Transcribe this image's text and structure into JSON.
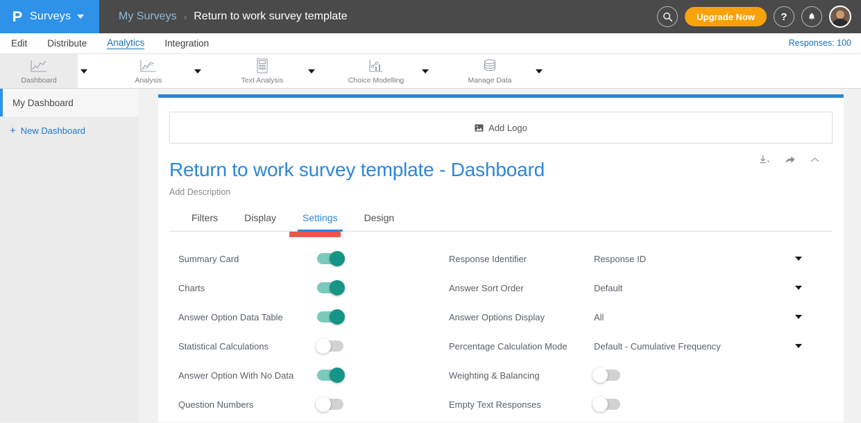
{
  "topbar": {
    "brand_logo": "P",
    "brand_name": "Surveys",
    "breadcrumb_parent": "My Surveys",
    "breadcrumb_sep": "›",
    "breadcrumb_current": "Return to work survey template",
    "search_icon": "search-icon",
    "upgrade_label": "Upgrade Now",
    "help_icon": "question-mark-icon",
    "notifications_icon": "bell-icon",
    "avatar": "user-avatar"
  },
  "navtabs": {
    "items": [
      {
        "label": "Edit",
        "active": false
      },
      {
        "label": "Distribute",
        "active": false
      },
      {
        "label": "Analytics",
        "active": true
      },
      {
        "label": "Integration",
        "active": false
      }
    ],
    "responses": "Responses: 100"
  },
  "toolbar": {
    "items": [
      {
        "label": "Dashboard",
        "icon": "line-chart-icon",
        "selected": true,
        "caret": true
      },
      {
        "label": "Analysis",
        "icon": "analysis-chart-icon",
        "selected": false,
        "caret": true
      },
      {
        "label": "Text Analysis",
        "icon": "text-analysis-icon",
        "selected": false,
        "caret": true
      },
      {
        "label": "Choice Modelling",
        "icon": "choice-modelling-icon",
        "selected": false,
        "caret": true
      },
      {
        "label": "Manage Data",
        "icon": "database-icon",
        "selected": false,
        "caret": true
      }
    ]
  },
  "sidebar": {
    "current_dashboard": "My Dashboard",
    "new_dashboard_label": "New Dashboard",
    "plus_icon": "plus-icon"
  },
  "main": {
    "add_logo_label": "Add Logo",
    "add_logo_icon": "image-icon",
    "dashboard_title": "Return to work survey template - Dashboard",
    "add_description": "Add Description",
    "actions": [
      {
        "name": "download-icon",
        "label": "Download"
      },
      {
        "name": "share-icon",
        "label": "Share"
      },
      {
        "name": "collapse-chevron-icon",
        "label": "Collapse"
      }
    ],
    "tabs": [
      {
        "label": "Filters",
        "active": false
      },
      {
        "label": "Display",
        "active": false
      },
      {
        "label": "Settings",
        "active": true
      },
      {
        "label": "Design",
        "active": false
      }
    ],
    "settings_left": [
      {
        "label": "Summary Card",
        "state": "on"
      },
      {
        "label": "Charts",
        "state": "on"
      },
      {
        "label": "Answer Option Data Table",
        "state": "on"
      },
      {
        "label": "Statistical Calculations",
        "state": "off"
      },
      {
        "label": "Answer Option With No Data",
        "state": "on"
      },
      {
        "label": "Question Numbers",
        "state": "off"
      }
    ],
    "settings_right": [
      {
        "label": "Response Identifier",
        "type": "select",
        "value": "Response ID"
      },
      {
        "label": "Answer Sort Order",
        "type": "select",
        "value": "Default"
      },
      {
        "label": "Answer Options Display",
        "type": "select",
        "value": "All"
      },
      {
        "label": "Percentage Calculation Mode",
        "type": "select",
        "value": "Default - Cumulative Frequency"
      },
      {
        "label": "Weighting & Balancing",
        "type": "toggle",
        "state": "off"
      },
      {
        "label": "Empty Text Responses",
        "type": "toggle",
        "state": "off"
      }
    ]
  },
  "colors": {
    "brand_blue": "#2e92e8",
    "accent_blue": "#2b87da",
    "upgrade_orange": "#f7a20b",
    "toggle_on": "#169485",
    "toggle_track_on": "#7ac9bd",
    "annotation_red": "#e8574a",
    "topbar_gray": "#4a4a4a"
  }
}
